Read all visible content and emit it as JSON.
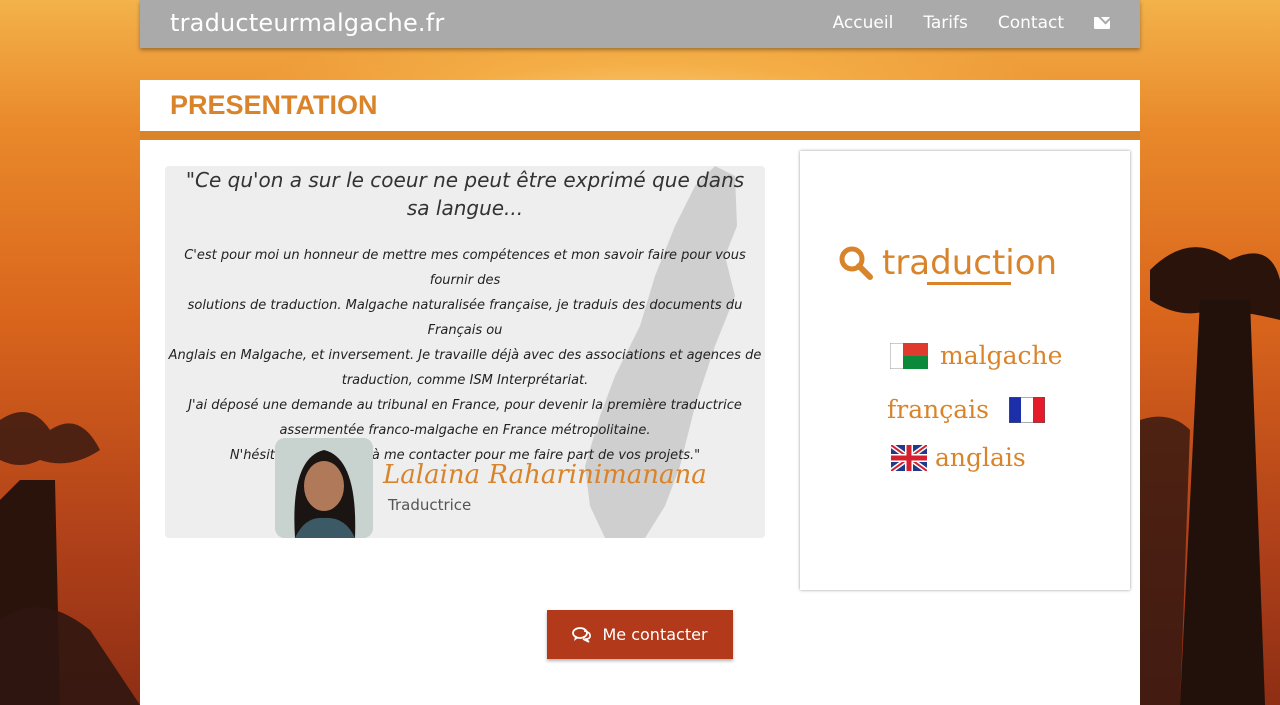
{
  "site": {
    "brand": "traducteurmalgache.fr"
  },
  "nav": {
    "items": [
      "Accueil",
      "Tarifs",
      "Contact"
    ],
    "mail_icon": "envelope-icon"
  },
  "page": {
    "title": "PRESENTATION"
  },
  "quote": {
    "headline": "\"Ce qu'on a sur le coeur ne peut être exprimé que dans sa langue...",
    "lines": [
      "C'est pour moi un honneur de mettre mes compétences et mon savoir faire pour vous fournir des",
      "solutions de traduction. Malgache naturalisée française, je traduis des documents du Français ou",
      "Anglais en Malgache, et inversement. Je travaille déjà avec des associations et agences de",
      "traduction, comme ISM Interprétariat.",
      "J'ai déposé une demande au tribunal en France, pour devenir la première traductrice",
      "assermentée franco-malgache en France métropolitaine.",
      "N'hésitez surtout pas à me contacter pour me faire part de vos projets.\""
    ],
    "author_name": "Lalaina Raharinimanana",
    "author_role": "Traductrice"
  },
  "side": {
    "logo_word": "traduction",
    "languages": [
      {
        "label": "malgache",
        "flag": "madagascar-flag"
      },
      {
        "label": "français",
        "flag": "france-flag"
      },
      {
        "label": "anglais",
        "flag": "uk-flag"
      }
    ]
  },
  "cta": {
    "label": "Me contacter",
    "icon": "comments-icon"
  },
  "colors": {
    "accent": "#d9842a",
    "cta": "#b2391a",
    "header": "#aaaaaa"
  }
}
